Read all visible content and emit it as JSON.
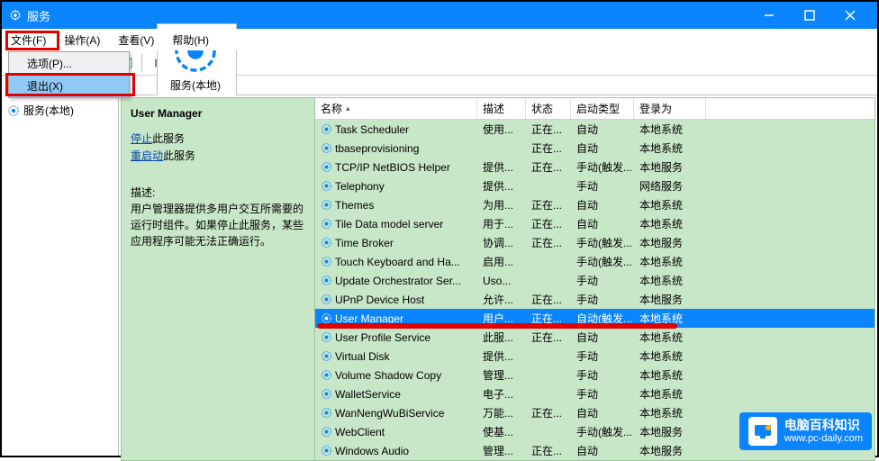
{
  "window": {
    "title": "服务"
  },
  "menu": {
    "file": "文件(F)",
    "action": "操作(A)",
    "view": "查看(V)",
    "help": "帮助(H)"
  },
  "file_menu": {
    "options": "选项(P)...",
    "exit": "退出(X)"
  },
  "tree": {
    "root": "服务(本地)"
  },
  "tab": {
    "label": "服务(本地)"
  },
  "detail": {
    "heading": "User Manager",
    "stop_link": "停止",
    "stop_suffix": "此服务",
    "restart_link": "重启动",
    "restart_suffix": "此服务",
    "desc_label": "描述:",
    "desc_body": "用户管理器提供多用户交互所需要的运行时组件。如果停止此服务，某些应用程序可能无法正确运行。"
  },
  "columns": {
    "name": "名称",
    "desc": "描述",
    "status": "状态",
    "startup": "启动类型",
    "logon": "登录为"
  },
  "services": [
    {
      "name": "Task Scheduler",
      "desc": "使用...",
      "status": "正在...",
      "startup": "自动",
      "logon": "本地系统"
    },
    {
      "name": "tbaseprovisioning",
      "desc": "",
      "status": "正在...",
      "startup": "自动",
      "logon": "本地系统"
    },
    {
      "name": "TCP/IP NetBIOS Helper",
      "desc": "提供...",
      "status": "正在...",
      "startup": "手动(触发...",
      "logon": "本地服务"
    },
    {
      "name": "Telephony",
      "desc": "提供...",
      "status": "",
      "startup": "手动",
      "logon": "网络服务"
    },
    {
      "name": "Themes",
      "desc": "为用...",
      "status": "正在...",
      "startup": "自动",
      "logon": "本地系统"
    },
    {
      "name": "Tile Data model server",
      "desc": "用于...",
      "status": "正在...",
      "startup": "自动",
      "logon": "本地系统"
    },
    {
      "name": "Time Broker",
      "desc": "协调...",
      "status": "正在...",
      "startup": "手动(触发...",
      "logon": "本地服务"
    },
    {
      "name": "Touch Keyboard and Ha...",
      "desc": "启用...",
      "status": "",
      "startup": "手动(触发...",
      "logon": "本地系统"
    },
    {
      "name": "Update Orchestrator Ser...",
      "desc": "Uso...",
      "status": "",
      "startup": "手动",
      "logon": "本地系统"
    },
    {
      "name": "UPnP Device Host",
      "desc": "允许...",
      "status": "正在...",
      "startup": "手动",
      "logon": "本地服务"
    },
    {
      "name": "User Manager",
      "desc": "用户...",
      "status": "正在...",
      "startup": "自动(触发...",
      "logon": "本地系统",
      "selected": true
    },
    {
      "name": "User Profile Service",
      "desc": "此服...",
      "status": "正在...",
      "startup": "自动",
      "logon": "本地系统"
    },
    {
      "name": "Virtual Disk",
      "desc": "提供...",
      "status": "",
      "startup": "手动",
      "logon": "本地系统"
    },
    {
      "name": "Volume Shadow Copy",
      "desc": "管理...",
      "status": "",
      "startup": "手动",
      "logon": "本地系统"
    },
    {
      "name": "WalletService",
      "desc": "电子...",
      "status": "",
      "startup": "手动",
      "logon": "本地系统"
    },
    {
      "name": "WanNengWuBiService",
      "desc": "万能...",
      "status": "正在...",
      "startup": "自动",
      "logon": "本地系统"
    },
    {
      "name": "WebClient",
      "desc": "使基...",
      "status": "",
      "startup": "手动(触发...",
      "logon": "本地服务"
    },
    {
      "name": "Windows Audio",
      "desc": "管理...",
      "status": "正在...",
      "startup": "自动",
      "logon": "本地服务"
    }
  ],
  "watermark": {
    "title": "电脑百科知识",
    "url": "www.pc-daily.com"
  }
}
